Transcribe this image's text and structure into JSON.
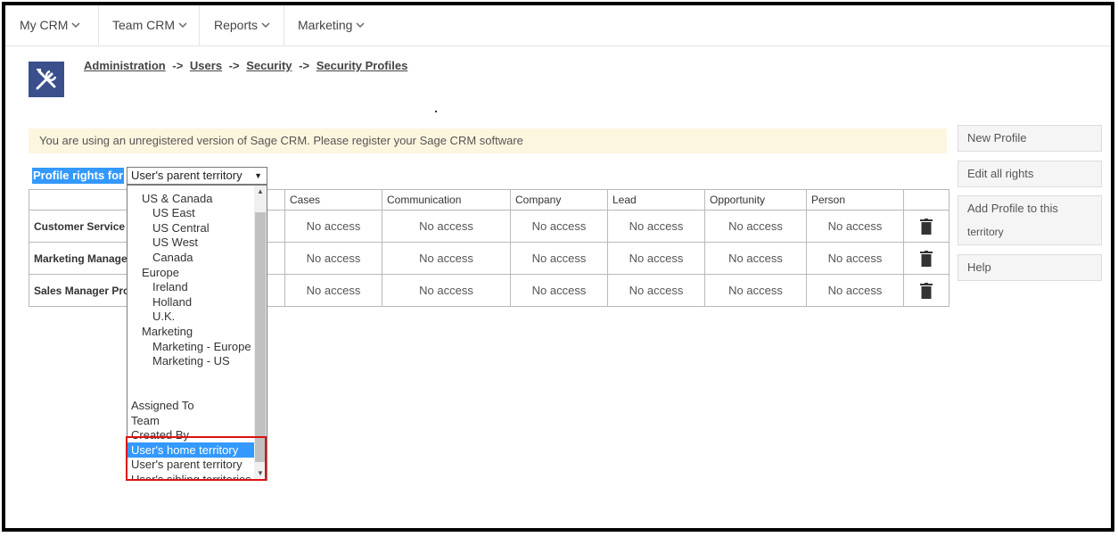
{
  "nav": {
    "items": [
      {
        "label": "My CRM"
      },
      {
        "label": "Team CRM"
      },
      {
        "label": "Reports"
      },
      {
        "label": "Marketing"
      }
    ]
  },
  "breadcrumb": {
    "items": [
      "Administration",
      "Users",
      "Security",
      "Security Profiles"
    ],
    "separator": "->"
  },
  "notice": "You are using an unregistered version of Sage CRM. Please register your Sage CRM software",
  "actions": {
    "new_profile": "New Profile",
    "edit_all_rights": "Edit all rights",
    "add_profile_line1": "Add Profile to this",
    "add_profile_line2": "territory",
    "help": "Help"
  },
  "profile_rights": {
    "label": "Profile rights for",
    "selected": "User's parent territory"
  },
  "table": {
    "headers": [
      "Cases",
      "Communication",
      "Company",
      "Lead",
      "Opportunity",
      "Person"
    ],
    "rows": [
      {
        "name": "Customer Service M",
        "cells": [
          "No access",
          "No access",
          "No access",
          "No access",
          "No access",
          "No access"
        ]
      },
      {
        "name": "Marketing Manager",
        "cells": [
          "No access",
          "No access",
          "No access",
          "No access",
          "No access",
          "No access"
        ]
      },
      {
        "name": "Sales Manager Prof",
        "cells": [
          "No access",
          "No access",
          "No access",
          "No access",
          "No access",
          "No access"
        ]
      }
    ]
  },
  "dropdown": {
    "options": [
      "US & Canada",
      "US East",
      "US Central",
      "US West",
      "Canada",
      "Europe",
      "Ireland",
      "Holland",
      "U.K.",
      "Marketing",
      "Marketing - Europe",
      "Marketing - US",
      "",
      "Assigned To",
      "Team",
      "Created By",
      "User's home territory",
      "User's parent territory",
      "User's sibling territories"
    ],
    "highlighted": "User's home territory"
  },
  "colors": {
    "selection": "#3399ff",
    "notice_bg": "#fdf6df",
    "highlight_border": "#dd1111",
    "admin_icon_bg": "#3a4f8c"
  }
}
